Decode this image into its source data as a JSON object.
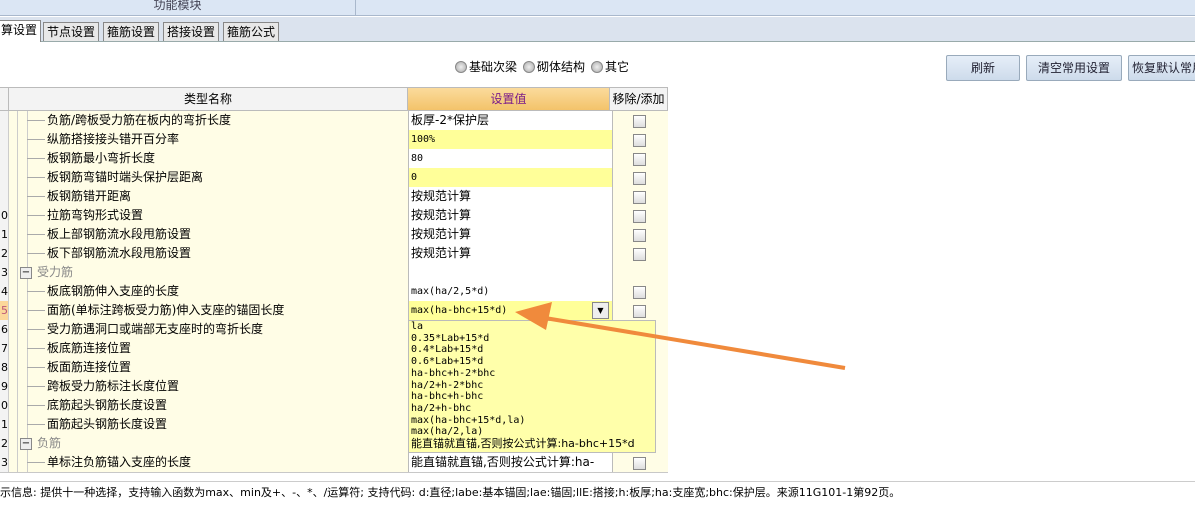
{
  "header": {
    "title": "功能模块"
  },
  "tabs": [
    "算设置",
    "节点设置",
    "箍筋设置",
    "搭接设置",
    "箍筋公式"
  ],
  "radios": [
    "基础次梁",
    "砌体结构",
    "其它"
  ],
  "buttons": {
    "refresh": "刷新",
    "clear": "清空常用设置",
    "restore": "恢复默认常用"
  },
  "columns": {
    "name": "类型名称",
    "value": "设置值",
    "toggle": "移除/添加"
  },
  "colors": {
    "accent_header": "#f5c872",
    "highlight_value": "#ffff99",
    "arrow": "#f08a3c"
  },
  "rows": [
    {
      "num": "",
      "name": "负筋/跨板受力筋在板内的弯折长度",
      "value": "板厚-2*保护层",
      "cn": true
    },
    {
      "num": "",
      "name": "纵筋搭接接头错开百分率",
      "value": "100%",
      "y": true
    },
    {
      "num": "",
      "name": "板钢筋最小弯折长度",
      "value": "80"
    },
    {
      "num": "",
      "name": "板钢筋弯锚时端头保护层距离",
      "value": "0",
      "y": true
    },
    {
      "num": "",
      "name": "板钢筋错开距离",
      "value": "按规范计算",
      "cn": true
    },
    {
      "num": "0",
      "name": "拉筋弯钩形式设置",
      "value": "按规范计算",
      "cn": true
    },
    {
      "num": "1",
      "name": "板上部钢筋流水段甩筋设置",
      "value": "按规范计算",
      "cn": true
    },
    {
      "num": "2",
      "name": "板下部钢筋流水段甩筋设置",
      "value": "按规范计算",
      "cn": true
    },
    {
      "num": "3",
      "name": "受力筋",
      "group": true
    },
    {
      "num": "4",
      "name": "板底钢筋伸入支座的长度",
      "value": "max(ha/2,5*d)"
    },
    {
      "num": "5",
      "name": "面筋(单标注跨板受力筋)伸入支座的锚固长度",
      "value": "max(ha-bhc+15*d)",
      "y": true,
      "sel": true
    },
    {
      "num": "6",
      "name": "受力筋遇洞口或端部无支座时的弯折长度"
    },
    {
      "num": "7",
      "name": "板底筋连接位置"
    },
    {
      "num": "8",
      "name": "板面筋连接位置"
    },
    {
      "num": "9",
      "name": "跨板受力筋标注长度位置"
    },
    {
      "num": "0",
      "name": "底筋起头钢筋长度设置"
    },
    {
      "num": "1",
      "name": "面筋起头钢筋长度设置"
    },
    {
      "num": "2",
      "name": "负筋",
      "group": true
    },
    {
      "num": "3",
      "name": "单标注负筋锚入支座的长度",
      "value": "能直锚就直锚,否则按公式计算:ha-",
      "cn": true
    }
  ],
  "dropdown_options": [
    "la",
    "0.35*Lab+15*d",
    "0.4*Lab+15*d",
    "0.6*Lab+15*d",
    "ha-bhc+h-2*bhc",
    "ha/2+h-2*bhc",
    "ha-bhc+h-bhc",
    "ha/2+h-bhc",
    "max(ha-bhc+15*d,la)",
    "max(ha/2,la)",
    "能直锚就直锚,否则按公式计算:ha-bhc+15*d"
  ],
  "status": "示信息: 提供十一种选择，支持输入函数为max、min及+、-、*、/运算符; 支持代码: d:直径;labe:基本锚固;lae:锚固;llE:搭接;h:板厚;ha:支座宽;bhc:保护层。来源11G101-1第92页。"
}
